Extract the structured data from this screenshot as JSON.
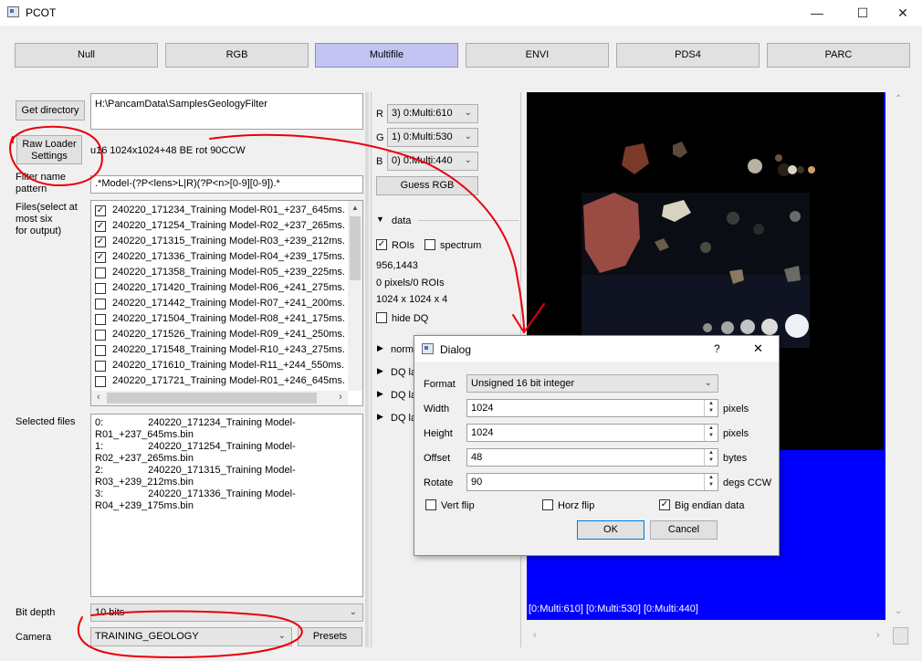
{
  "window": {
    "title": "PCOT",
    "minimize": "—",
    "maximize": "☐",
    "close": "✕"
  },
  "modes": [
    "Null",
    "RGB",
    "Multifile",
    "ENVI",
    "PDS4",
    "PARC"
  ],
  "active_mode": "Multifile",
  "left": {
    "get_directory": "Get directory",
    "directory": "H:\\PancamData\\SamplesGeologyFilter",
    "raw_loader_1": "Raw Loader",
    "raw_loader_2": "Settings",
    "raw_info": "u16 1024x1024+48 BE rot 90CCW",
    "filter_label_1": "Filter name",
    "filter_label_2": "pattern",
    "filter_pattern": ".*Model-(?P<lens>L|R)(?P<n>[0-9][0-9]).*",
    "files_label_1": "Files(select at",
    "files_label_2": "most six",
    "files_label_3": "for output)",
    "files": [
      {
        "name": "240220_171234_Training Model-R01_+237_645ms.",
        "checked": true
      },
      {
        "name": "240220_171254_Training Model-R02_+237_265ms.",
        "checked": true
      },
      {
        "name": "240220_171315_Training Model-R03_+239_212ms.",
        "checked": true
      },
      {
        "name": "240220_171336_Training Model-R04_+239_175ms.",
        "checked": true
      },
      {
        "name": "240220_171358_Training Model-R05_+239_225ms.",
        "checked": false
      },
      {
        "name": "240220_171420_Training Model-R06_+241_275ms.",
        "checked": false
      },
      {
        "name": "240220_171442_Training Model-R07_+241_200ms.",
        "checked": false
      },
      {
        "name": "240220_171504_Training Model-R08_+241_175ms.",
        "checked": false
      },
      {
        "name": "240220_171526_Training Model-R09_+241_250ms.",
        "checked": false
      },
      {
        "name": "240220_171548_Training Model-R10_+243_275ms.",
        "checked": false
      },
      {
        "name": "240220_171610_Training Model-R11_+244_550ms.",
        "checked": false
      },
      {
        "name": "240220_171721_Training Model-R01_+246_645ms.",
        "checked": false
      }
    ],
    "selected_label": "Selected files",
    "selected": [
      "0:                240220_171234_Training Model-",
      "R01_+237_645ms.bin",
      "1:                240220_171254_Training Model-",
      "R02_+237_265ms.bin",
      "2:                240220_171315_Training Model-",
      "R03_+239_212ms.bin",
      "3:                240220_171336_Training Model-",
      "R04_+239_175ms.bin"
    ],
    "bit_depth_label": "Bit depth",
    "bit_depth": "10 bits",
    "camera_label": "Camera",
    "camera": "TRAINING_GEOLOGY",
    "presets": "Presets"
  },
  "middle": {
    "r_label": "R",
    "r_value": "3) 0:Multi:610",
    "g_label": "G",
    "g_value": "1) 0:Multi:530",
    "b_label": "B",
    "b_value": "0) 0:Multi:440",
    "guess_rgb": "Guess RGB",
    "data_label": "data",
    "rois_label": "ROIs",
    "spectrum_label": "spectrum",
    "coords": "956,1443",
    "pixels_rois": "0 pixels/0 ROIs",
    "dims": "1024 x 1024 x 4",
    "hide_dq": "hide DQ",
    "norm_label": "norm",
    "dq1": "DQ la",
    "dq2": "DQ la",
    "dq3": "DQ la"
  },
  "canvas": {
    "label": "[0:Multi:610] [0:Multi:530] [0:Multi:440]"
  },
  "dialog": {
    "title": "Dialog",
    "help": "?",
    "close": "✕",
    "format_label": "Format",
    "format_value": "Unsigned 16 bit integer",
    "width_label": "Width",
    "width_value": "1024",
    "width_unit": "pixels",
    "height_label": "Height",
    "height_value": "1024",
    "height_unit": "pixels",
    "offset_label": "Offset",
    "offset_value": "48",
    "offset_unit": "bytes",
    "rotate_label": "Rotate",
    "rotate_value": "90",
    "rotate_unit": "degs CCW",
    "vert_flip": "Vert flip",
    "horz_flip": "Horz flip",
    "big_endian": "Big endian data",
    "ok": "OK",
    "cancel": "Cancel"
  },
  "colors": {
    "active_mode": "#c4c4f2",
    "annotation": "#e8000a",
    "canvas_blue": "#0000ff"
  }
}
